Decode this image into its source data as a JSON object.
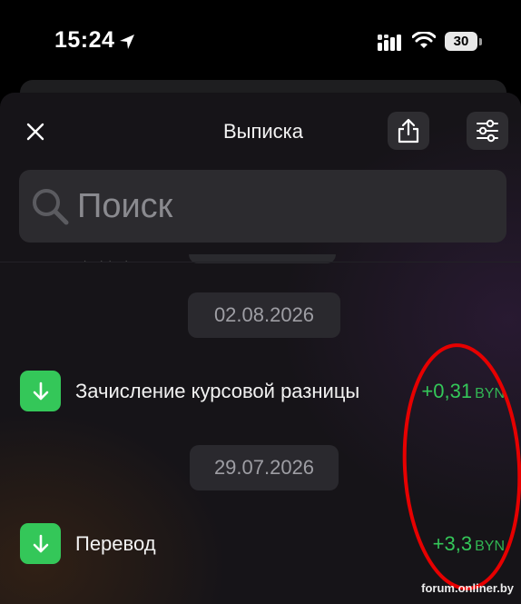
{
  "status_bar": {
    "time": "15:24",
    "battery": "30"
  },
  "header": {
    "title": "Выписка"
  },
  "search": {
    "placeholder": "Поиск",
    "value": ""
  },
  "groups": [
    {
      "date": "02.08.2026",
      "transactions": [
        {
          "title": "Зачисление курсовой разницы",
          "amount": "+0,31",
          "currency": "BYN"
        }
      ]
    },
    {
      "date": "29.07.2026",
      "transactions": [
        {
          "title": "Перевод",
          "amount": "+3,3",
          "currency": "BYN"
        }
      ]
    }
  ],
  "watermark": "forum.onliner.by",
  "colors": {
    "income": "#34c759",
    "annotation": "#e60000",
    "background": "#000000"
  },
  "icons": [
    "location-arrow-icon",
    "signal-icon",
    "wifi-icon",
    "close-icon",
    "share-icon",
    "filter-icon",
    "search-icon",
    "arrow-down-icon"
  ]
}
